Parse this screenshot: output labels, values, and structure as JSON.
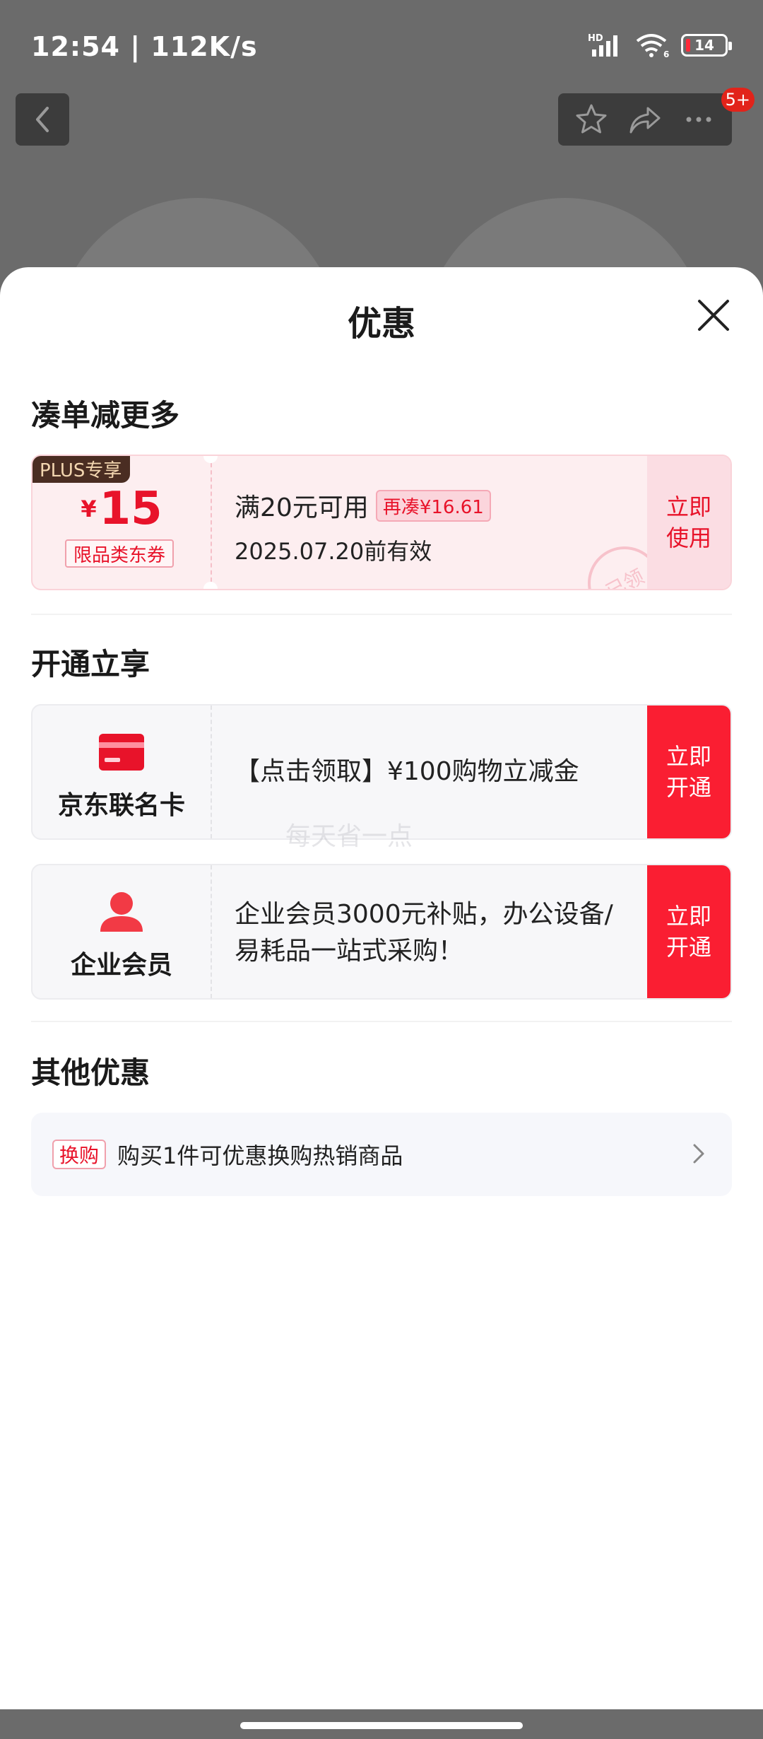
{
  "status_bar": {
    "time": "12:54",
    "speed": "112K/s",
    "network": "HD",
    "wifi_label": "6",
    "battery": "14"
  },
  "background_page": {
    "badge": "5+"
  },
  "sheet": {
    "title": "优惠",
    "sections": {
      "more_title": "凑单减更多",
      "open_title": "开通立享",
      "other_title": "其他优惠"
    }
  },
  "coupon": {
    "tag": "PLUS专享",
    "currency": "¥",
    "amount": "15",
    "scope": "限品类东券",
    "condition": "满20元可用",
    "extra": "再凑¥16.61",
    "valid_until": "2025.07.20前有效",
    "action_line1": "立即",
    "action_line2": "使用",
    "stamp": "已领"
  },
  "members": [
    {
      "name": "京东联名卡",
      "icon": "credit-card-icon",
      "desc": "【点击领取】¥100购物立减金",
      "action_line1": "立即",
      "action_line2": "开通"
    },
    {
      "name": "企业会员",
      "icon": "user-icon",
      "desc": " 企业会员3000元补贴，办公设备/易耗品一站式采购！",
      "action_line1": "立即",
      "action_line2": "开通"
    }
  ],
  "watermark": "每天省一点",
  "exchange": {
    "tag": "换购",
    "text": "购买1件可优惠换购热销商品"
  },
  "colors": {
    "accent": "#fa1e32",
    "coupon_bg": "#fdeef0",
    "plus_tag_bg": "#4a2d22"
  }
}
